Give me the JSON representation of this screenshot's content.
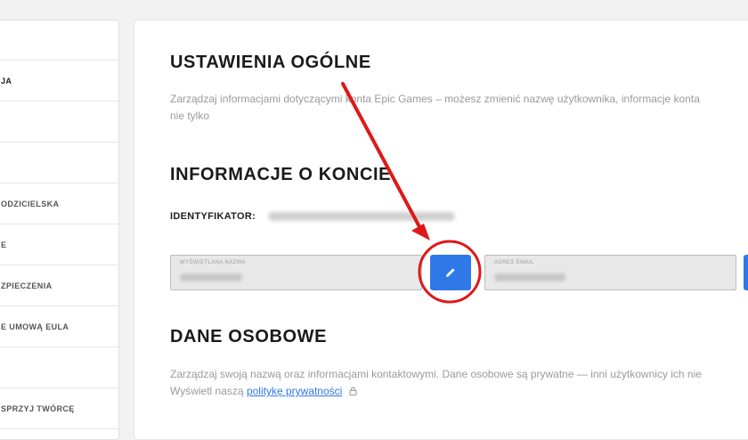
{
  "sidebar": {
    "items": [
      {
        "label": ""
      },
      {
        "label": "JA"
      },
      {
        "label": ""
      },
      {
        "label": ""
      },
      {
        "label": "ODZICIELSKA"
      },
      {
        "label": "E"
      },
      {
        "label": "ZPIECZENIA"
      },
      {
        "label": "E UMOWĄ EULA"
      },
      {
        "label": ""
      },
      {
        "label": "SPRZYJ TWÓRCĘ"
      }
    ]
  },
  "main": {
    "general_title": "USTAWIENIA OGÓLNE",
    "general_desc_line1": "Zarządzaj informacjami dotyczącymi konta Epic Games – możesz zmienić nazwę użytkownika, informacje konta",
    "general_desc_line2": "nie tylko",
    "account_title": "INFORMACJE O KONCIE",
    "id_label": "IDENTYFIKATOR:",
    "display_name_label": "WYŚWIETLANA NAZWA",
    "email_label": "ADRES EMAIL",
    "personal_title": "DANE OSOBOWE",
    "personal_desc_line1": "Zarządzaj swoją nazwą oraz informacjami kontaktowymi. Dane osobowe są prywatne — inni użytkownicy ich nie",
    "personal_desc_prefix": "Wyświetl naszą",
    "privacy_link": "politykę prywatności"
  },
  "colors": {
    "accent": "#2f78e8",
    "annotation": "#e01818"
  },
  "icons": {
    "edit": "pencil-icon",
    "lock": "lock-icon"
  }
}
